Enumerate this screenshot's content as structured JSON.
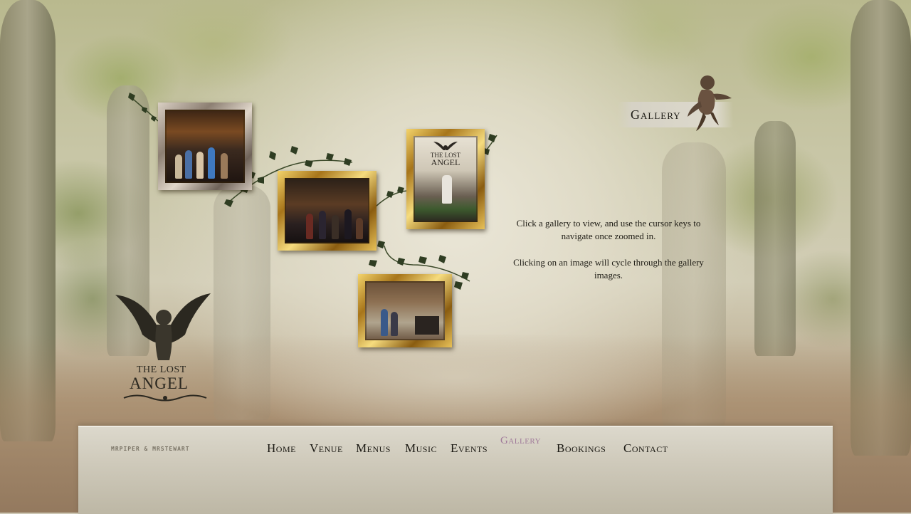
{
  "site": {
    "logo": {
      "line1": "THE LOST",
      "line2": "ANGEL"
    },
    "credit": "MRPIPER & MRSTEWART"
  },
  "page": {
    "heading": "Gallery",
    "instructions": [
      "Click a gallery to view, and use the cursor keys to navigate once zoomed in.",
      "Clicking on an image will cycle through the gallery images."
    ]
  },
  "galleries": [
    {
      "frame": "silver"
    },
    {
      "frame": "gold"
    },
    {
      "frame": "gold",
      "poster_line1": "THE LOST",
      "poster_line2": "ANGEL"
    },
    {
      "frame": "gold"
    }
  ],
  "nav": {
    "items": [
      {
        "label": "Home"
      },
      {
        "label": "Venue"
      },
      {
        "label": "Menus"
      },
      {
        "label": "Music"
      },
      {
        "label": "Events"
      },
      {
        "label": "Gallery",
        "active": true
      },
      {
        "label": "Bookings"
      },
      {
        "label": "Contact"
      }
    ]
  },
  "colors": {
    "text": "#1a1812",
    "active_nav": "#a07a9a",
    "gold_frame": "#c99a2e",
    "silver_frame": "#a89a8c",
    "ivy": "#2f3d22"
  }
}
